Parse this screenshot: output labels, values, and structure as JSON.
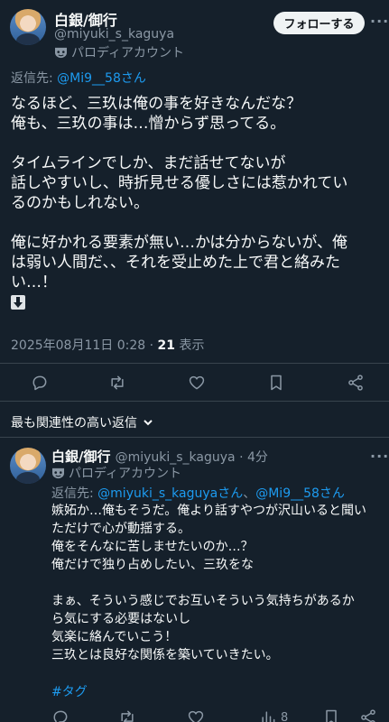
{
  "tweet": {
    "author_name": "白銀/御行",
    "author_handle": "@miyuki_s_kaguya",
    "parody_label": "パロディアカウント",
    "follow_label": "フォローする",
    "reply_prefix": "返信先: ",
    "reply_to": "@Mi9__58さん",
    "lines": [
      "なるほど、三玖は俺の事を好きなんだな？",
      "俺も、三玖の事は…憎からず思ってる。",
      "",
      "タイムラインでしか、まだ話せてないが",
      "話しやすいし、時折見せる優しさには惹かれてい",
      "るのかもしれない。",
      "",
      "俺に好かれる要素が無い…かは分からないが、俺",
      "は弱い人間だ、、それを受止めた上で君と絡みた",
      "い…！"
    ],
    "timestamp": "2025年08月11日 0:28",
    "separator": " · ",
    "views_count": "21",
    "views_label": " 表示",
    "more_icon": "more-horizontal-icon"
  },
  "sort": {
    "label": "最も関連性の高い返信"
  },
  "reply": {
    "author_name": "白銀/御行",
    "author_handle": "@miyuki_s_kaguya",
    "time_sep": " · ",
    "time": "4分",
    "parody_label": "パロディアカウント",
    "reply_prefix": "返信先: ",
    "reply_to_1": "@miyuki_s_kaguyaさん",
    "reply_to_sep": "、",
    "reply_to_2": "@Mi9__58さん",
    "lines": [
      "嫉妬か…俺もそうだ。俺より話すやつが沢山いると聞い",
      "ただけで心が動揺する。",
      "俺をそんなに苦しませたいのか…？",
      "俺だけで独り占めしたい、三玖をな",
      "",
      "まぁ、そういう感じでお互いそういう気持ちがあるか",
      "ら気にする必要はないし",
      "気楽に絡んでいこう！",
      "三玖とは良好な関係を築いていきたい。"
    ],
    "hashtag": "#タグ",
    "views_count": "8"
  },
  "colors": {
    "background": "#15202b",
    "accent": "#1d9bf0",
    "text": "#f7f9f9",
    "muted": "#8b98a5"
  }
}
